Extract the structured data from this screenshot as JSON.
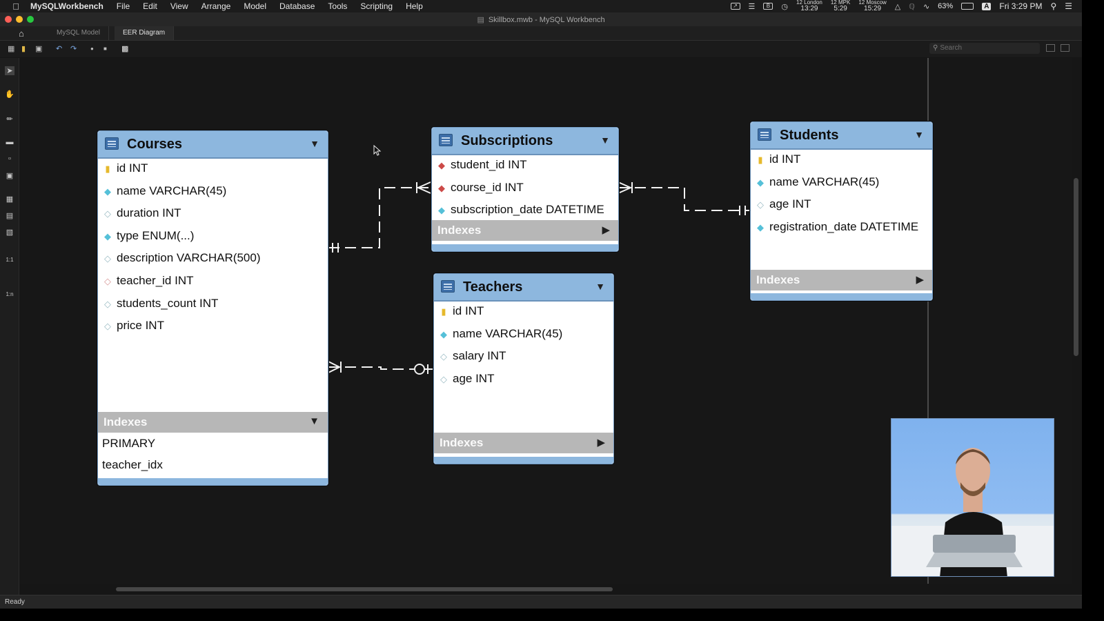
{
  "menubar": {
    "app_name": "MySQLWorkbench",
    "items": [
      "File",
      "Edit",
      "View",
      "Arrange",
      "Model",
      "Database",
      "Tools",
      "Scripting",
      "Help"
    ],
    "clocks": [
      {
        "label": "12 London",
        "time": "13:29"
      },
      {
        "label": "12 MPK",
        "time": "5:29"
      },
      {
        "label": "12 Moscow",
        "time": "15:29"
      }
    ],
    "battery": "63%",
    "input_source": "A",
    "datetime": "Fri 3:29 PM"
  },
  "window": {
    "title": "Skillbox.mwb - MySQL Workbench"
  },
  "tabs": [
    {
      "label": "MySQL Model"
    },
    {
      "label": "EER Diagram"
    }
  ],
  "toolbar": {
    "search_placeholder": "Search"
  },
  "diagram": {
    "tables": {
      "courses": {
        "name": "Courses",
        "columns": [
          {
            "key": "pk",
            "text": "id INT"
          },
          {
            "key": "nn",
            "text": "name VARCHAR(45)"
          },
          {
            "key": "null",
            "text": "duration INT"
          },
          {
            "key": "nn",
            "text": "type ENUM(...)"
          },
          {
            "key": "null",
            "text": "description VARCHAR(500)"
          },
          {
            "key": "fkn",
            "text": "teacher_id INT"
          },
          {
            "key": "null",
            "text": "students_count INT"
          },
          {
            "key": "null",
            "text": "price INT"
          }
        ],
        "indexes_label": "Indexes",
        "indexes": [
          "PRIMARY",
          "teacher_idx"
        ]
      },
      "subscriptions": {
        "name": "Subscriptions",
        "columns": [
          {
            "key": "fk",
            "text": "student_id INT"
          },
          {
            "key": "fk",
            "text": "course_id INT"
          },
          {
            "key": "nn",
            "text": "subscription_date DATETIME"
          }
        ],
        "indexes_label": "Indexes"
      },
      "students": {
        "name": "Students",
        "columns": [
          {
            "key": "pk",
            "text": "id INT"
          },
          {
            "key": "nn",
            "text": "name VARCHAR(45)"
          },
          {
            "key": "null",
            "text": "age INT"
          },
          {
            "key": "nn",
            "text": "registration_date DATETIME"
          }
        ],
        "indexes_label": "Indexes"
      },
      "teachers": {
        "name": "Teachers",
        "columns": [
          {
            "key": "pk",
            "text": "id INT"
          },
          {
            "key": "nn",
            "text": "name VARCHAR(45)"
          },
          {
            "key": "null",
            "text": "salary INT"
          },
          {
            "key": "null",
            "text": "age INT"
          }
        ],
        "indexes_label": "Indexes"
      }
    }
  },
  "status": {
    "text": "Ready"
  },
  "colors": {
    "header": "#8db7de",
    "indexes_bar": "#b7b7b7",
    "canvas": "#171717"
  }
}
